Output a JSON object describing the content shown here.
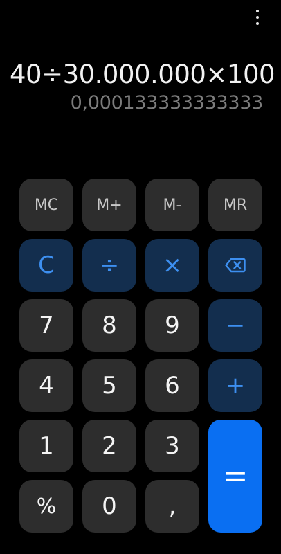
{
  "display": {
    "expression": "40÷30.000.000×100",
    "result": "0,000133333333333"
  },
  "menu": {
    "icon": "more-vert-icon"
  },
  "keys": {
    "mc": "MC",
    "m_plus": "M+",
    "m_minus": "M-",
    "mr": "MR",
    "clear": "C",
    "divide": "÷",
    "multiply": "×",
    "backspace_icon": "backspace-icon",
    "seven": "7",
    "eight": "8",
    "nine": "9",
    "minus": "−",
    "four": "4",
    "five": "5",
    "six": "6",
    "plus": "+",
    "one": "1",
    "two": "2",
    "three": "3",
    "equals": "=",
    "percent": "%",
    "zero": "0",
    "comma": ","
  },
  "colors": {
    "background": "#000000",
    "key": "#2d2d2d",
    "operator_key": "#132e4e",
    "operator_text": "#3d8ff0",
    "equals_key": "#0a6ff2",
    "result_text": "#7c7c7c"
  }
}
